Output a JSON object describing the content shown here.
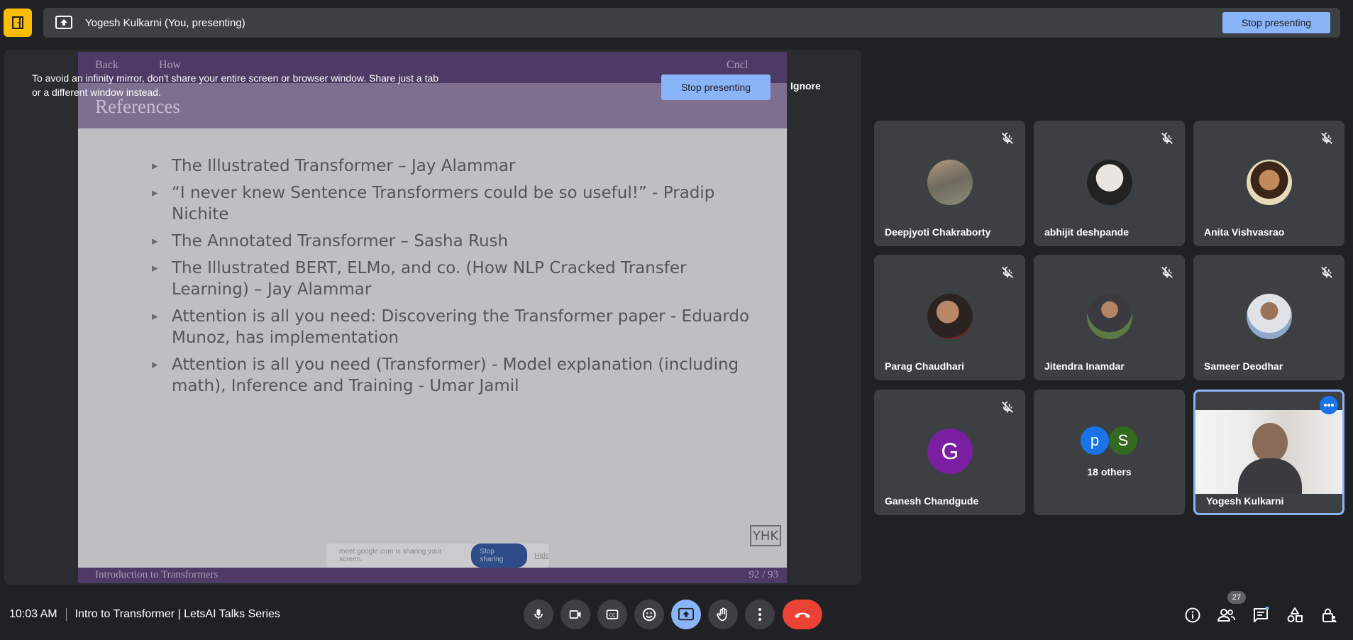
{
  "top_bar": {
    "presenter_label": "Yogesh Kulkarni (You, presenting)",
    "stop_presenting_label": "Stop presenting"
  },
  "warning": {
    "message": "To avoid an infinity mirror, don't share your entire screen or browser window. Share just a tab or a different window instead.",
    "stop_presenting_label": "Stop presenting",
    "ignore_label": "Ignore"
  },
  "slide": {
    "nav_back": "Back",
    "nav_how": "How",
    "nav_cncl": "Cncl",
    "title": "References",
    "bullets": [
      "The Illustrated Transformer – Jay Alammar",
      "“I never knew Sentence Transformers could be so useful!” - Pradip Nichite",
      "The Annotated Transformer – Sasha Rush",
      "The Illustrated BERT, ELMo, and co. (How NLP Cracked Transfer Learning) – Jay Alammar",
      "Attention is all you need: Discovering the Transformer paper - Eduardo Munoz, has implementation",
      "Attention is all you need (Transformer) - Model explanation (including math), Inference and Training - Umar Jamil"
    ],
    "logo": "YHK",
    "share_notice": "meet.google.com is sharing your screen.",
    "share_stop": "Stop sharing",
    "share_hide": "Hide",
    "footer_title": "Introduction to Transformers",
    "page": "92 / 93"
  },
  "participants": [
    {
      "name": "Deepjyoti Chakraborty",
      "muted": true
    },
    {
      "name": "abhijit deshpande",
      "muted": true
    },
    {
      "name": "Anita Vishvasrao",
      "muted": true
    },
    {
      "name": "Parag Chaudhari",
      "muted": true
    },
    {
      "name": "Jitendra Inamdar",
      "muted": true
    },
    {
      "name": "Sameer Deodhar",
      "muted": true
    },
    {
      "name": "Ganesh Chandgude",
      "muted": true,
      "initial": "G",
      "color": "#7b1fa2"
    },
    {
      "others_label": "18 others",
      "initials": [
        "p",
        "S"
      ],
      "colors": [
        "#1a73e8",
        "#33691e"
      ]
    },
    {
      "name": "Yogesh Kulkarni",
      "self": true
    }
  ],
  "bottom_bar": {
    "time": "10:03 AM",
    "meeting_title": "Intro to Transformer | LetsAI Talks Series",
    "participant_count": "27"
  },
  "colors": {
    "accent": "#8ab4f8",
    "end_call": "#ea4335",
    "home": "#fbbc04"
  }
}
